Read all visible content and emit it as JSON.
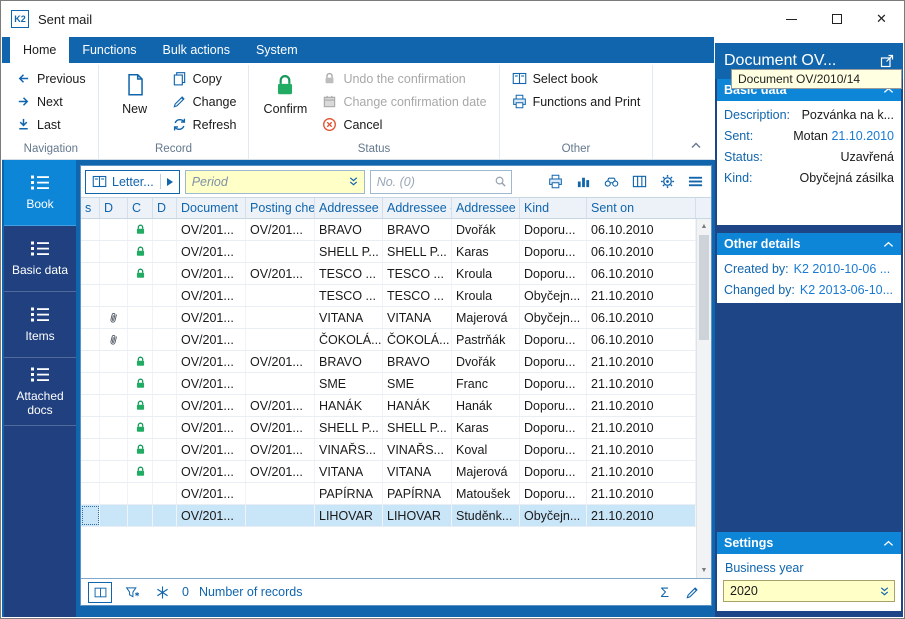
{
  "window": {
    "title": "Sent mail",
    "app_badge": "K2"
  },
  "icons": {
    "sigma": "Σ",
    "scroll_up": "▲",
    "scroll_down": "▼",
    "close": "✕"
  },
  "colors": {
    "accent": "#1065ad",
    "section_header": "#0d86d8",
    "sidebar": "#20407f",
    "selected_row": "#c9e5f8",
    "confirmed_lock_green": "#22ab62",
    "cancel_red": "#e0512f",
    "filter_yellow": "#ffffc8",
    "link_blue": "#1a7ad1"
  },
  "tabs": [
    {
      "label": "Home",
      "active": true
    },
    {
      "label": "Functions",
      "active": false
    },
    {
      "label": "Bulk actions",
      "active": false
    },
    {
      "label": "System",
      "active": false
    }
  ],
  "ribbon": {
    "navigation": {
      "label": "Navigation",
      "previous": "Previous",
      "next": "Next",
      "last": "Last"
    },
    "record": {
      "label": "Record",
      "new": "New",
      "copy": "Copy",
      "change": "Change",
      "refresh": "Refresh"
    },
    "status": {
      "label": "Status",
      "confirm": "Confirm",
      "undo": "Undo the confirmation",
      "change_date": "Change confirmation date",
      "cancel": "Cancel"
    },
    "other": {
      "label": "Other",
      "select_book": "Select book",
      "functions_print": "Functions and Print"
    }
  },
  "sidebar": {
    "items": [
      {
        "label": "Book",
        "active": true
      },
      {
        "label": "Basic data",
        "active": false
      },
      {
        "label": "Items",
        "active": false
      },
      {
        "label": "Attached docs",
        "active": false
      }
    ]
  },
  "toolbar": {
    "book_button": "Letter...",
    "period_placeholder": "Period",
    "search_placeholder": "No. (0)"
  },
  "grid": {
    "columns": [
      "s",
      "D",
      "C",
      "D",
      "Document",
      "Posting che...",
      "Addressee -",
      "Addressee -",
      "Addressee -",
      "Kind",
      "Sent on"
    ],
    "rows": [
      {
        "attach": false,
        "lock": true,
        "document": "OV/201...",
        "posting": "OV/201...",
        "addressee1": "BRAVO",
        "addressee2": "BRAVO",
        "addressee3": "Dvořák",
        "kind": "Doporu...",
        "sent_on": "06.10.2010",
        "selected": false
      },
      {
        "attach": false,
        "lock": true,
        "document": "OV/201...",
        "posting": "",
        "addressee1": "SHELL P...",
        "addressee2": "SHELL P...",
        "addressee3": "Karas",
        "kind": "Doporu...",
        "sent_on": "06.10.2010",
        "selected": false
      },
      {
        "attach": false,
        "lock": true,
        "document": "OV/201...",
        "posting": "OV/201...",
        "addressee1": "TESCO ...",
        "addressee2": "TESCO ...",
        "addressee3": "Kroula",
        "kind": "Doporu...",
        "sent_on": "06.10.2010",
        "selected": false
      },
      {
        "attach": false,
        "lock": false,
        "document": "OV/201...",
        "posting": "",
        "addressee1": "TESCO ...",
        "addressee2": "TESCO ...",
        "addressee3": "Kroula",
        "kind": "Obyčejn...",
        "sent_on": "21.10.2010",
        "selected": false
      },
      {
        "attach": true,
        "lock": false,
        "document": "OV/201...",
        "posting": "",
        "addressee1": "VITANA",
        "addressee2": "VITANA",
        "addressee3": "Majerová",
        "kind": "Obyčejn...",
        "sent_on": "06.10.2010",
        "selected": false
      },
      {
        "attach": true,
        "lock": false,
        "document": "OV/201...",
        "posting": "",
        "addressee1": "ČOKOLÁ...",
        "addressee2": "ČOKOLÁ...",
        "addressee3": "Pastrňák",
        "kind": "Doporu...",
        "sent_on": "06.10.2010",
        "selected": false
      },
      {
        "attach": false,
        "lock": true,
        "document": "OV/201...",
        "posting": "OV/201...",
        "addressee1": "BRAVO",
        "addressee2": "BRAVO",
        "addressee3": "Dvořák",
        "kind": "Doporu...",
        "sent_on": "21.10.2010",
        "selected": false
      },
      {
        "attach": false,
        "lock": true,
        "document": "OV/201...",
        "posting": "",
        "addressee1": "SME",
        "addressee2": "SME",
        "addressee3": "Franc",
        "kind": "Doporu...",
        "sent_on": "21.10.2010",
        "selected": false
      },
      {
        "attach": false,
        "lock": true,
        "document": "OV/201...",
        "posting": "OV/201...",
        "addressee1": "HANÁK",
        "addressee2": "HANÁK",
        "addressee3": "Hanák",
        "kind": "Doporu...",
        "sent_on": "21.10.2010",
        "selected": false
      },
      {
        "attach": false,
        "lock": true,
        "document": "OV/201...",
        "posting": "OV/201...",
        "addressee1": "SHELL P...",
        "addressee2": "SHELL P...",
        "addressee3": "Karas",
        "kind": "Doporu...",
        "sent_on": "21.10.2010",
        "selected": false
      },
      {
        "attach": false,
        "lock": true,
        "document": "OV/201...",
        "posting": "OV/201...",
        "addressee1": "VINAŘS...",
        "addressee2": "VINAŘS...",
        "addressee3": "Koval",
        "kind": "Doporu...",
        "sent_on": "21.10.2010",
        "selected": false
      },
      {
        "attach": false,
        "lock": true,
        "document": "OV/201...",
        "posting": "OV/201...",
        "addressee1": "VITANA",
        "addressee2": "VITANA",
        "addressee3": "Majerová",
        "kind": "Doporu...",
        "sent_on": "21.10.2010",
        "selected": false
      },
      {
        "attach": false,
        "lock": false,
        "document": "OV/201...",
        "posting": "",
        "addressee1": "PAPÍRNA",
        "addressee2": "PAPÍRNA",
        "addressee3": "Matoušek",
        "kind": "Doporu...",
        "sent_on": "21.10.2010",
        "selected": false
      },
      {
        "attach": false,
        "lock": false,
        "document": "OV/201...",
        "posting": "",
        "addressee1": "LIHOVAR",
        "addressee2": "LIHOVAR",
        "addressee3": "Studěnk...",
        "kind": "Obyčejn...",
        "sent_on": "21.10.2010",
        "selected": true
      }
    ]
  },
  "statusbar": {
    "count": "0",
    "records_label": "Number of records"
  },
  "panel": {
    "title": "Document OV...",
    "tooltip": "Document OV/2010/14",
    "basic": {
      "header": "Basic data",
      "description_label": "Description:",
      "description": "Pozvánka na k...",
      "sent_label": "Sent:",
      "sent_name": "Motan",
      "sent_date": "21.10.2010",
      "status_label": "Status:",
      "status": "Uzavřená",
      "kind_label": "Kind:",
      "kind": "Obyčejná zásilka"
    },
    "other_details": {
      "header": "Other details",
      "created_label": "Created by:",
      "created": "K2 2010-10-06 ...",
      "changed_label": "Changed by:",
      "changed": "K2 2013-06-10..."
    },
    "settings": {
      "header": "Settings",
      "business_year_label": "Business year",
      "business_year": "2020"
    }
  }
}
